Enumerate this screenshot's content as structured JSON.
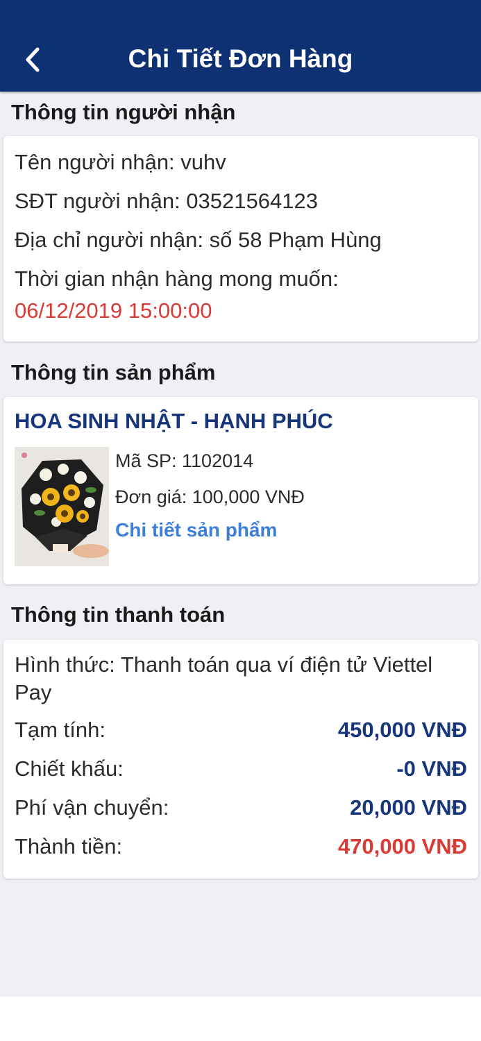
{
  "header": {
    "title": "Chi Tiết Đơn Hàng",
    "back_icon": "chevron-left-icon",
    "background": "#0e3174"
  },
  "recipient": {
    "section_title": "Thông tin người nhận",
    "name_label": "Tên người nhận: vuhv",
    "phone_label": "SĐT người nhận: 03521564123",
    "address_label": "Địa chỉ người nhận:",
    "address_value": "số 58 Phạm Hùng",
    "time_label": "Thời gian nhận hàng mong muốn:",
    "time_value": "06/12/2019 15:00:00"
  },
  "product": {
    "section_title": "Thông tin sản phẩm",
    "name": "HOA SINH NHẬT - HẠNH PHÚC",
    "code": "Mã SP: 1102014",
    "price": "Đơn giá: 100,000 VNĐ",
    "detail_link": "Chi tiết sản phẩm",
    "image": "sunflower-bouquet-photo"
  },
  "payment": {
    "section_title": "Thông tin thanh toán",
    "method": "Hình thức: Thanh toán qua ví điện tử Viettel Pay",
    "rows": [
      {
        "label": "Tạm tính:",
        "value": "450,000 VNĐ"
      },
      {
        "label": "Chiết khấu:",
        "value": "-0 VNĐ"
      },
      {
        "label": "Phí vận chuyển:",
        "value": "20,000 VNĐ"
      },
      {
        "label": "Thành tiền:",
        "value": "470,000 VNĐ"
      }
    ]
  },
  "colors": {
    "accent": "#16357a",
    "highlight_red": "#d93a33",
    "link": "#3d7fd6",
    "background": "#eef0f5"
  }
}
